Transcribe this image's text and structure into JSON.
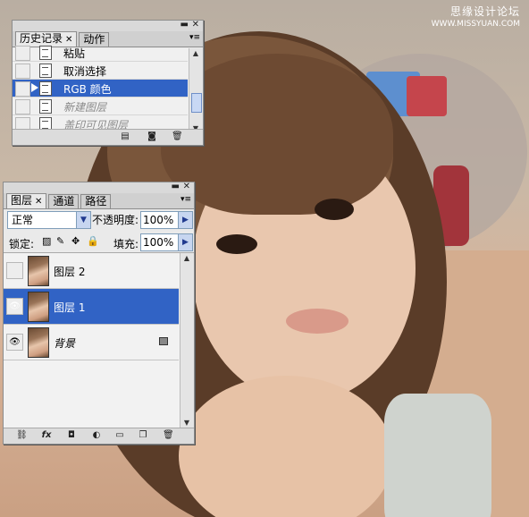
{
  "watermark": {
    "title": "思缘设计论坛",
    "url": "WWW.MISSYUAN.COM"
  },
  "history_panel": {
    "tabs": [
      {
        "label": "历史记录",
        "active": true
      },
      {
        "label": "动作",
        "active": false
      }
    ],
    "items": [
      {
        "label": "粘贴",
        "state": "normal"
      },
      {
        "label": "取消选择",
        "state": "normal"
      },
      {
        "label": "RGB 颜色",
        "state": "selected"
      },
      {
        "label": "新建图层",
        "state": "dimmed"
      },
      {
        "label": "盖印可见图层",
        "state": "dimmed"
      }
    ],
    "footer_icons": [
      "new-document-from-state-icon",
      "snapshot-camera-icon",
      "trash-icon"
    ]
  },
  "layers_panel": {
    "tabs": [
      {
        "label": "图层",
        "active": true
      },
      {
        "label": "通道",
        "active": false
      },
      {
        "label": "路径",
        "active": false
      }
    ],
    "blend_mode": "正常",
    "opacity_label": "不透明度:",
    "opacity_value": "100%",
    "lock_label": "锁定:",
    "fill_label": "填充:",
    "fill_value": "100%",
    "layers": [
      {
        "name": "图层 2",
        "visible": false,
        "selected": false,
        "locked": false
      },
      {
        "name": "图层 1",
        "visible": true,
        "selected": true,
        "locked": false
      },
      {
        "name": "背景",
        "visible": true,
        "selected": false,
        "locked": true
      }
    ],
    "footer_icons": [
      "link-icon",
      "fx-icon",
      "mask-icon",
      "adjustment-icon",
      "folder-icon",
      "new-layer-icon",
      "trash-icon"
    ]
  },
  "colors": {
    "selection": "#3163c5",
    "panel_bg": "#eaeaea"
  }
}
